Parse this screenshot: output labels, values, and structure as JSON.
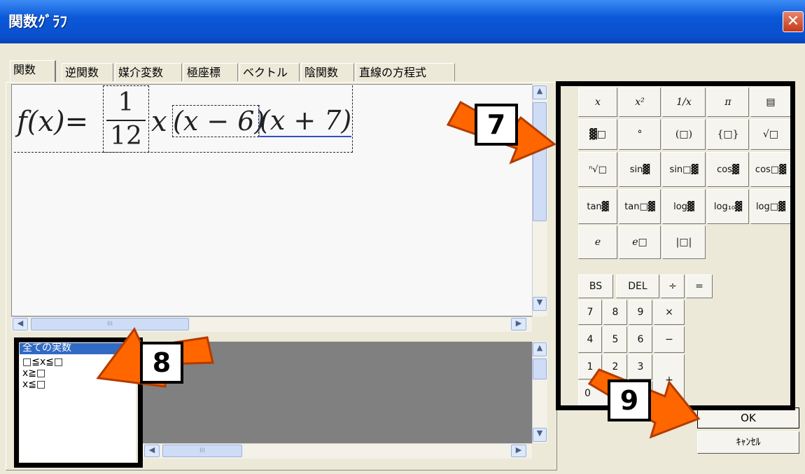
{
  "window": {
    "title": "関数ｸﾞﾗﾌ",
    "close_symbol": "✕"
  },
  "tabs": [
    "関数",
    "逆関数",
    "媒介変数",
    "極座標",
    "ベクトル",
    "陰関数",
    "直線の方程式"
  ],
  "active_tab": "関数",
  "formula": {
    "lhs": "f(x)=",
    "frac_num": "1",
    "frac_den": "12",
    "x": "x",
    "factor1": "(x − 6)",
    "factor2": "(x + 7)"
  },
  "range_list": {
    "items": [
      "全ての実数",
      "□≦x≦□",
      "x≧□",
      "x≦□"
    ],
    "selected_index": 0
  },
  "scroll_hint": "III",
  "keypad": {
    "math_keys": [
      [
        "x",
        "x²",
        "1/x",
        "π",
        "▤"
      ],
      [
        "▓□",
        "°",
        "(□)",
        "{□}",
        "√□"
      ],
      [
        "ⁿ√□",
        "sin▓",
        "sin□▓",
        "cos▓",
        "cos□▓"
      ],
      [
        "tan▓",
        "tan□▓",
        "log▓",
        "log₁₀▓",
        "log□▓"
      ],
      [
        "e",
        "e□",
        "|□|"
      ]
    ],
    "edit_keys": [
      "BS",
      "DEL",
      "÷",
      "="
    ],
    "digit_rows": [
      [
        "7",
        "8",
        "9",
        "×"
      ],
      [
        "4",
        "5",
        "6",
        "−"
      ],
      [
        "1",
        "2",
        "3",
        "+"
      ],
      [
        "0"
      ]
    ]
  },
  "buttons": {
    "ok": "OK",
    "cancel": "ｷｬﾝｾﾙ"
  },
  "annotations": {
    "callout_7": "7",
    "callout_8": "8",
    "callout_9": "9",
    "arrow_color": "#ff6600"
  }
}
